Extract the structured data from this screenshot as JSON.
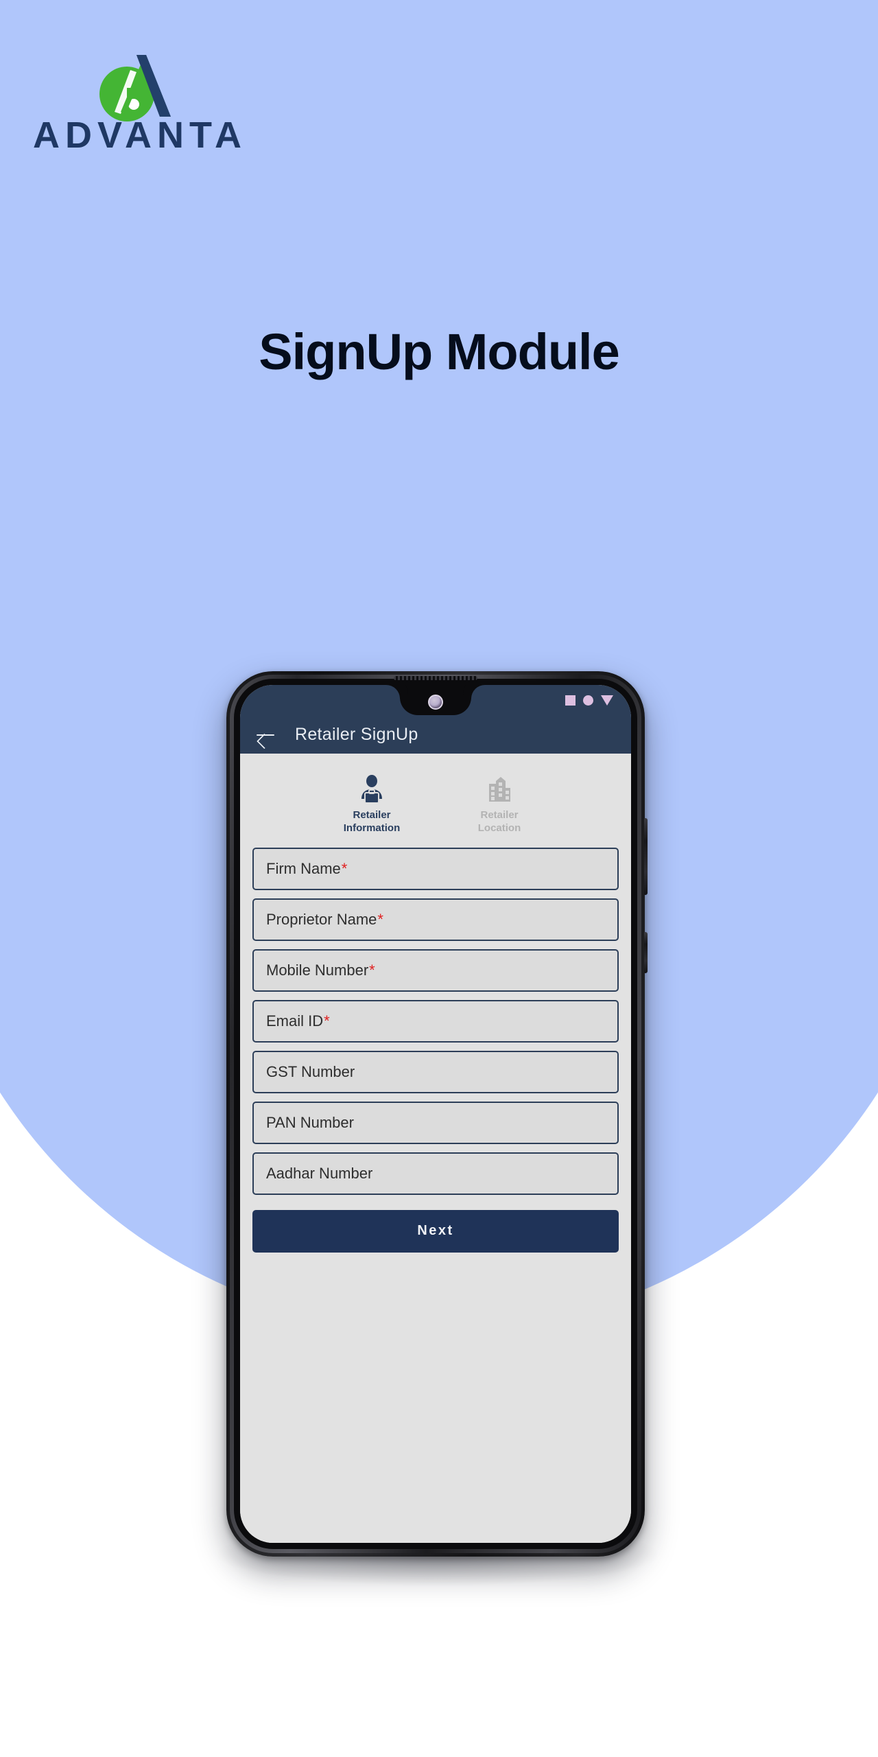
{
  "brand": {
    "wordmark": "ADVANTA",
    "mark_icon": "advanta-leaf-a-logo",
    "green": "#44b534",
    "navy": "#1f3864"
  },
  "page": {
    "title": "SignUp Module",
    "background_blue": "#b0c6fb",
    "background_white": "#ffffff"
  },
  "phone": {
    "status_bar": {
      "icons": [
        "square-icon",
        "circle-icon",
        "triangle-down-icon"
      ],
      "icon_color": "#ddbfe0",
      "bar_color": "#2c3e58"
    },
    "app_bar": {
      "back_icon": "back-arrow-icon",
      "title": "Retailer SignUp",
      "bar_color": "#2c3e58",
      "title_color": "#e9edf3"
    },
    "stepper": {
      "steps": [
        {
          "label_line1": "Retailer",
          "label_line2": "Information",
          "icon": "person-briefcase-icon",
          "state": "active",
          "color": "#2a3f5f"
        },
        {
          "label_line1": "Retailer",
          "label_line2": "Location",
          "icon": "building-icon",
          "state": "inactive",
          "color": "#b3b3b3"
        }
      ]
    },
    "form": {
      "fields": [
        {
          "label": "Firm Name",
          "required": true,
          "value": ""
        },
        {
          "label": "Proprietor Name",
          "required": true,
          "value": ""
        },
        {
          "label": "Mobile Number",
          "required": true,
          "value": ""
        },
        {
          "label": "Email ID",
          "required": true,
          "value": ""
        },
        {
          "label": "GST Number",
          "required": false,
          "value": ""
        },
        {
          "label": "PAN Number",
          "required": false,
          "value": ""
        },
        {
          "label": "Aadhar Number",
          "required": false,
          "value": ""
        }
      ],
      "required_marker": "*",
      "required_color": "#e02020",
      "field_border_color": "#2c3e58",
      "field_fill_color": "#dcdcdc"
    },
    "next_button": {
      "label": "Next",
      "background": "#1f3358",
      "text_color": "#f2f4f8"
    }
  }
}
